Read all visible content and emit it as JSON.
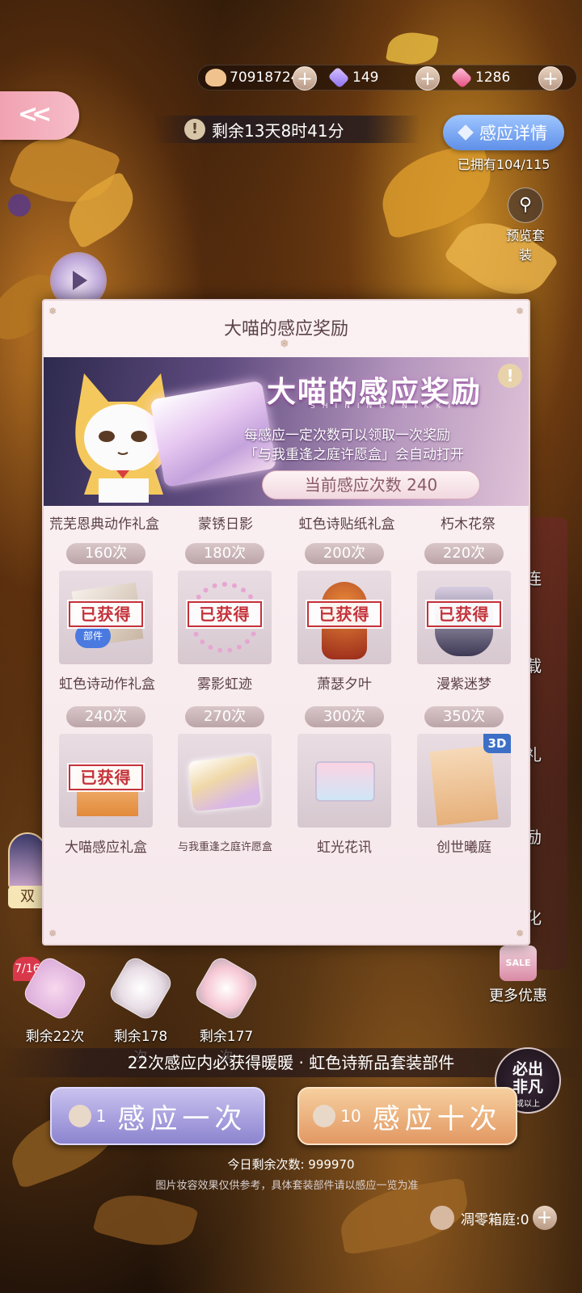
{
  "resources": {
    "coins": "70918724",
    "diamonds": "149",
    "crystals": "1286",
    "icons": [
      "cat-coin-icon",
      "purple-diamond-icon",
      "pink-diamond-icon",
      "plus-icon"
    ]
  },
  "timer": {
    "label": "剩余13天8时41分",
    "icon": "warning-icon"
  },
  "detail_button": {
    "label": "感应详情"
  },
  "owned_label": "已拥有104/115",
  "preview_label": "预览套装",
  "side_menu": [
    "连",
    "载",
    "礼",
    "励",
    "化"
  ],
  "more_offers": {
    "label": "更多优惠",
    "badge": "SALE"
  },
  "modal": {
    "title": "大喵的感应奖励",
    "banner": {
      "title": "大喵的感应奖励",
      "subtitle": "SHINING NIKKI",
      "desc_line1": "每感应一定次数可以领取一次奖励",
      "desc_line2": "「与我重逢之庭许愿盒」会自动打开",
      "count_label": "当前感应次数 240"
    },
    "top_row_names": [
      "荒芜恩典动作礼盒",
      "蒙锈日影",
      "虹色诗贴纸礼盒",
      "朽木花祭"
    ],
    "rows": [
      [
        {
          "count": "160次",
          "name": "虹色诗动作礼盒",
          "claimed": "已获得",
          "tag": "部件"
        },
        {
          "count": "180次",
          "name": "雾影虹迹",
          "claimed": "已获得"
        },
        {
          "count": "200次",
          "name": "萧瑟夕叶",
          "claimed": "已获得"
        },
        {
          "count": "220次",
          "name": "漫紫迷梦",
          "claimed": "已获得"
        }
      ],
      [
        {
          "count": "240次",
          "name": "大喵感应礼盒",
          "claimed": "已获得"
        },
        {
          "count": "270次",
          "name": "与我重逢之庭许愿盒"
        },
        {
          "count": "300次",
          "name": "虹光花讯"
        },
        {
          "count": "350次",
          "name": "创世曦庭",
          "tag3d": "3D"
        }
      ]
    ]
  },
  "bottom": {
    "progress": "7/16",
    "mini_items": [
      "剩余22次",
      "剩余178次",
      "剩余177次"
    ],
    "guarantee": "22次感应内必获得暖暖 · 虹色诗新品套装部件",
    "bifan": {
      "line1": "必出",
      "line2": "非凡",
      "line3": "或以上"
    },
    "draw_one": {
      "count": "1",
      "label": "感应一次"
    },
    "draw_ten": {
      "count": "10",
      "label": "感应十次"
    },
    "today_left": "今日剩余次数: 999970",
    "disclaimer": "图片妆容效果仅供参考，具体套装部件请以感应一览为准",
    "box_count": "凋零箱庭:0",
    "left_badge": "双"
  }
}
